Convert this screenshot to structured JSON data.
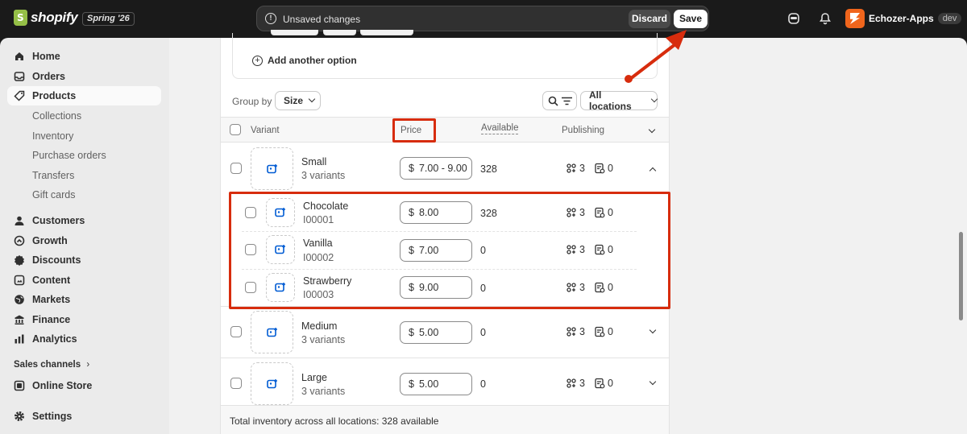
{
  "topbar": {
    "brand": "shopify",
    "edition": "Spring '26",
    "unsaved_message": "Unsaved changes",
    "discard_label": "Discard",
    "save_label": "Save",
    "store_name": "Echozer-Apps",
    "store_badge": "dev"
  },
  "sidebar": {
    "items": [
      {
        "label": "Home",
        "icon": "home-icon"
      },
      {
        "label": "Orders",
        "icon": "inbox-icon"
      },
      {
        "label": "Products",
        "icon": "tag-icon"
      },
      {
        "label": "Customers",
        "icon": "person-icon"
      },
      {
        "label": "Growth",
        "icon": "growth-icon"
      },
      {
        "label": "Discounts",
        "icon": "discount-icon"
      },
      {
        "label": "Content",
        "icon": "content-icon"
      },
      {
        "label": "Markets",
        "icon": "globe-icon"
      },
      {
        "label": "Finance",
        "icon": "bank-icon"
      },
      {
        "label": "Analytics",
        "icon": "chart-icon"
      },
      {
        "label": "Online Store",
        "icon": "store-icon"
      },
      {
        "label": "Settings",
        "icon": "gear-icon"
      }
    ],
    "product_subitems": [
      "Collections",
      "Inventory",
      "Purchase orders",
      "Transfers",
      "Gift cards"
    ],
    "sales_channels_label": "Sales channels"
  },
  "variants_card": {
    "add_option_label": "Add another option",
    "group_by_label": "Group by",
    "group_by_value": "Size",
    "locations_value": "All locations",
    "columns": {
      "variant": "Variant",
      "price": "Price",
      "available": "Available",
      "publishing": "Publishing"
    },
    "groups": [
      {
        "name": "Small",
        "sub": "3 variants",
        "currency": "$",
        "price": "7.00 - 9.00",
        "available": "328",
        "channels": "3",
        "catalogs": "0",
        "expanded": true
      },
      {
        "name": "Medium",
        "sub": "3 variants",
        "currency": "$",
        "price": "5.00",
        "available": "0",
        "channels": "3",
        "catalogs": "0",
        "expanded": false
      },
      {
        "name": "Large",
        "sub": "3 variants",
        "currency": "$",
        "price": "5.00",
        "available": "0",
        "channels": "3",
        "catalogs": "0",
        "expanded": false
      }
    ],
    "children": [
      {
        "name": "Chocolate",
        "sku": "I00001",
        "currency": "$",
        "price": "8.00",
        "available": "328",
        "channels": "3",
        "catalogs": "0"
      },
      {
        "name": "Vanilla",
        "sku": "I00002",
        "currency": "$",
        "price": "7.00",
        "available": "0",
        "channels": "3",
        "catalogs": "0"
      },
      {
        "name": "Strawberry",
        "sku": "I00003",
        "currency": "$",
        "price": "9.00",
        "available": "0",
        "channels": "3",
        "catalogs": "0"
      }
    ],
    "footer": "Total inventory across all locations: 328 available"
  },
  "colors": {
    "accent_annotation": "#d72c0d",
    "topbar_bg": "#1a1a1a",
    "sidebar_bg": "#ebebeb",
    "image_icon": "#005bd3"
  }
}
